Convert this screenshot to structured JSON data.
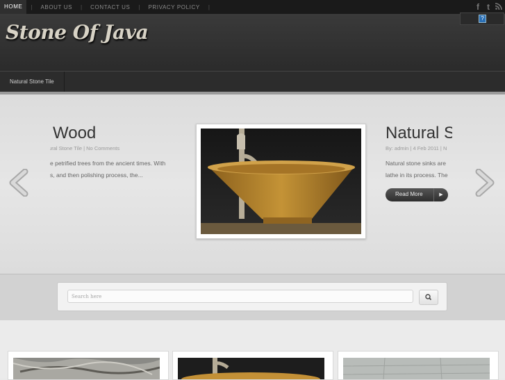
{
  "topnav": {
    "items": [
      "HOME",
      "ABOUT US",
      "CONTACT US",
      "PRIVACY POLICY"
    ],
    "separator": "|",
    "social_icons": [
      "facebook-icon",
      "twitter-icon",
      "rss-icon"
    ]
  },
  "header": {
    "logo": "Stone Of Java",
    "widget_icon": "question-icon"
  },
  "catbar": {
    "item": "Natural Stone Tile"
  },
  "slider": {
    "left": {
      "title": "d Wood",
      "meta": "tural Stone Tile | No Comments",
      "text_lines": [
        "e petrified trees from the ancient times. With",
        "s, and then polishing process, the..."
      ]
    },
    "right": {
      "title": "Natural S",
      "meta": "By: admin | 4 Feb 2011 | N",
      "text_lines": [
        "Natural stone sinks are",
        "lathe in its process. The"
      ],
      "read_more": "Read More"
    }
  },
  "search": {
    "placeholder": "Search here"
  },
  "colors": {
    "topbar": "#1a1a1a",
    "header": "#333333",
    "slider_bg": "#e2e2e2",
    "sink": "#b8862a"
  }
}
